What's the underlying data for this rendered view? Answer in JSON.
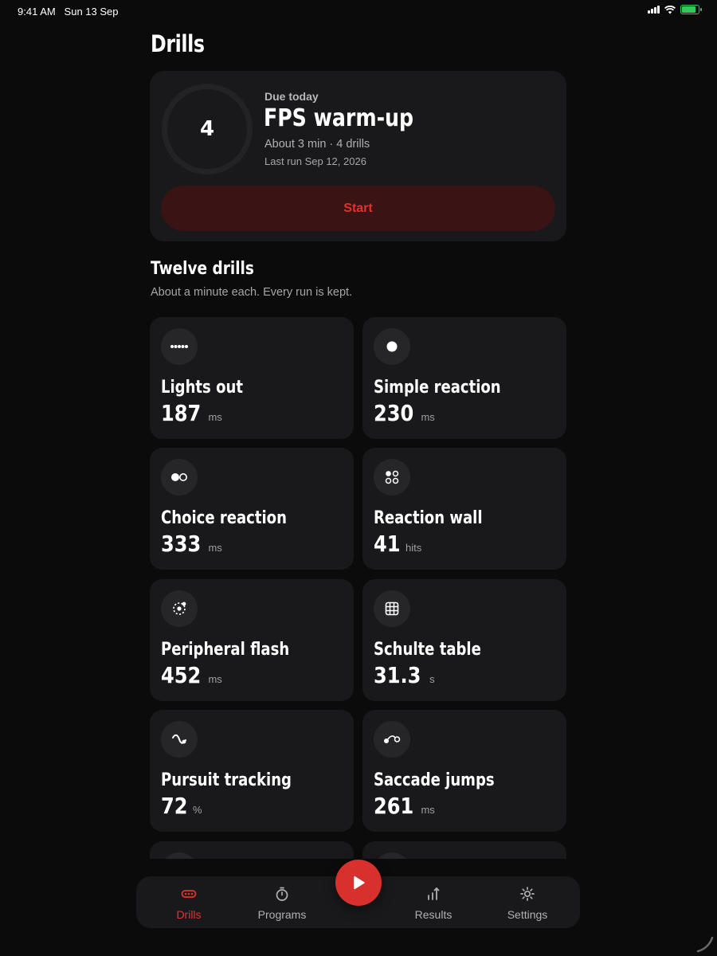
{
  "status_bar": {
    "time": "9:41 AM",
    "date": "Sun 13 Sep",
    "icons": [
      "signal-icon",
      "wifi-icon",
      "battery-charging-icon"
    ]
  },
  "page": {
    "title": "Drills"
  },
  "due_card": {
    "count": "4",
    "label": "Due today",
    "title": "FPS warm-up",
    "meta": "About 3 min · 4 drills",
    "last_run": "Last run Sep 12, 2026",
    "start_label": "Start"
  },
  "section": {
    "title": "Twelve drills",
    "subtitle": "About a minute each. Every run is kept."
  },
  "drills": [
    {
      "name": "Lights out",
      "value": "187",
      "unit": "ms",
      "icon": "lights-row-icon"
    },
    {
      "name": "Simple reaction",
      "value": "230",
      "unit": "ms",
      "icon": "dot-icon"
    },
    {
      "name": "Choice reaction",
      "value": "333",
      "unit": "ms",
      "icon": "two-dots-icon"
    },
    {
      "name": "Reaction wall",
      "value": "41",
      "unit": "hits",
      "icon": "four-dots-icon"
    },
    {
      "name": "Peripheral flash",
      "value": "452",
      "unit": "ms",
      "icon": "peripheral-icon"
    },
    {
      "name": "Schulte table",
      "value": "31.3",
      "unit": "s",
      "icon": "grid-icon"
    },
    {
      "name": "Pursuit tracking",
      "value": "72",
      "unit": "%",
      "icon": "wave-icon"
    },
    {
      "name": "Saccade jumps",
      "value": "261",
      "unit": "ms",
      "icon": "saccade-icon"
    },
    {
      "name": "",
      "value": "",
      "unit": "",
      "icon": ""
    },
    {
      "name": "",
      "value": "",
      "unit": "",
      "icon": ""
    }
  ],
  "tabs": [
    {
      "label": "Drills",
      "icon": "drills-icon",
      "active": true
    },
    {
      "label": "Programs",
      "icon": "stopwatch-icon",
      "active": false
    },
    {
      "label": "Results",
      "icon": "chart-up-icon",
      "active": false
    },
    {
      "label": "Settings",
      "icon": "gear-icon",
      "active": false
    }
  ],
  "colors": {
    "accent": "#d8302c",
    "card": "#19191b",
    "background": "#0b0b0c"
  }
}
